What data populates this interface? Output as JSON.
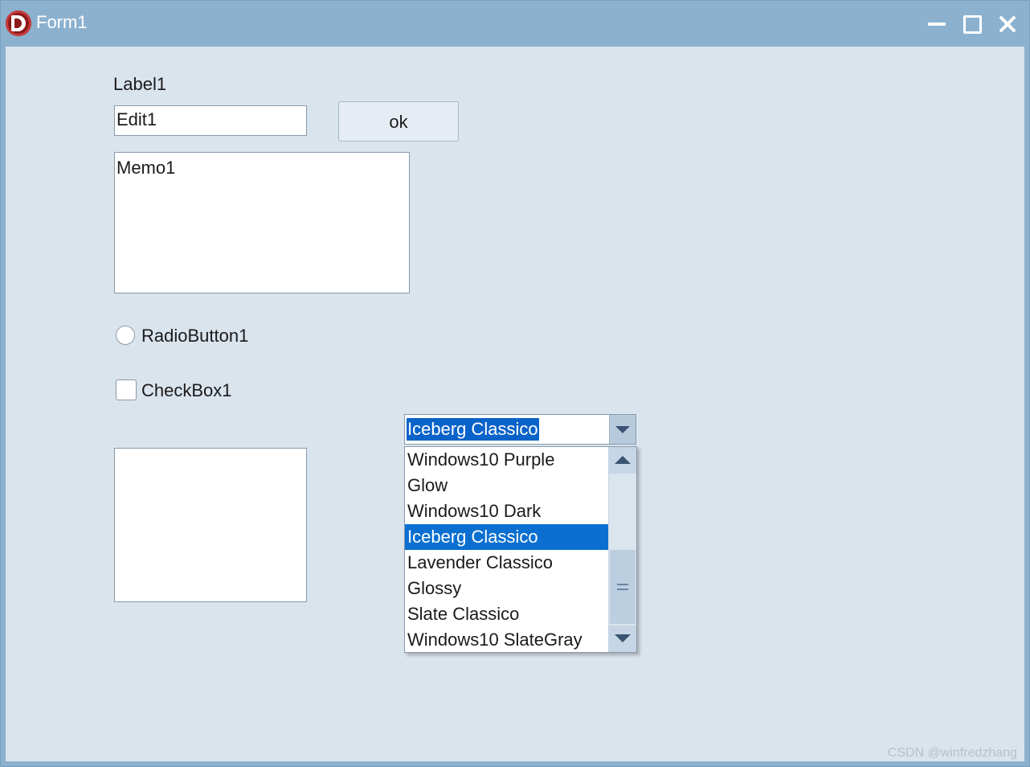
{
  "window": {
    "title": "Form1"
  },
  "form": {
    "label1": "Label1",
    "edit1_value": "Edit1",
    "ok_button": "ok",
    "memo1_text": "Memo1",
    "radio_label": "RadioButton1",
    "checkbox_label": "CheckBox1"
  },
  "combo": {
    "selected": "Iceberg Classico",
    "items": [
      "Windows10 Purple",
      "Glow",
      "Windows10 Dark",
      "Iceberg Classico",
      "Lavender Classico",
      "Glossy",
      "Slate Classico",
      "Windows10 SlateGray"
    ]
  },
  "watermark": "CSDN @winfredzhang",
  "colors": {
    "title_bar": "#8cb1cf",
    "form_bg": "#dae4ed",
    "selection": "#0a6fd0"
  }
}
